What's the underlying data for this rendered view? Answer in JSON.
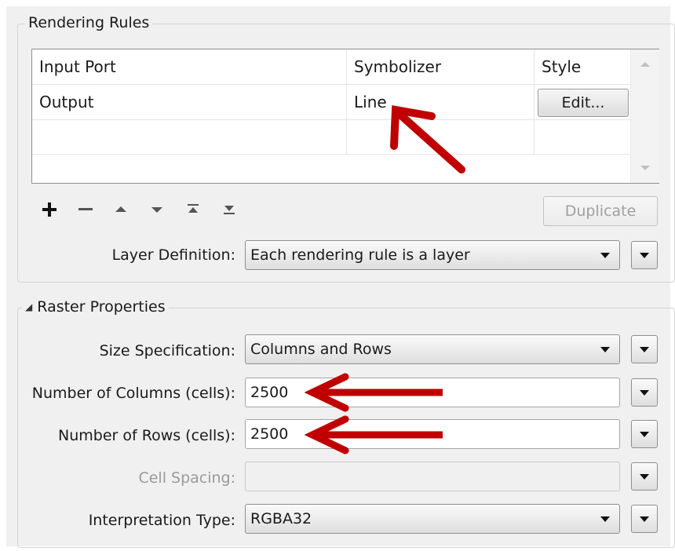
{
  "rendering_rules": {
    "title": "Rendering Rules",
    "columns": [
      "Input Port",
      "Symbolizer",
      "Style"
    ],
    "rows": [
      {
        "input_port": "Output",
        "symbolizer": "Line",
        "style_button": "Edit..."
      }
    ],
    "toolbar_icons": [
      "add-icon",
      "remove-icon",
      "move-up-icon",
      "move-down-icon",
      "move-top-icon",
      "move-bottom-icon"
    ],
    "duplicate_label": "Duplicate",
    "layer_definition": {
      "label": "Layer Definition:",
      "value": "Each rendering rule is a layer"
    }
  },
  "raster_properties": {
    "title": "Raster Properties",
    "size_specification": {
      "label": "Size Specification:",
      "value": "Columns and Rows"
    },
    "num_columns": {
      "label": "Number of Columns (cells):",
      "value": "2500"
    },
    "num_rows": {
      "label": "Number of Rows (cells):",
      "value": "2500"
    },
    "cell_spacing": {
      "label": "Cell Spacing:",
      "value": ""
    },
    "interpretation_type": {
      "label": "Interpretation Type:",
      "value": "RGBA32"
    }
  },
  "colors": {
    "annotation_arrow": "#c00000",
    "panel_bg": "#f0f0f0"
  }
}
